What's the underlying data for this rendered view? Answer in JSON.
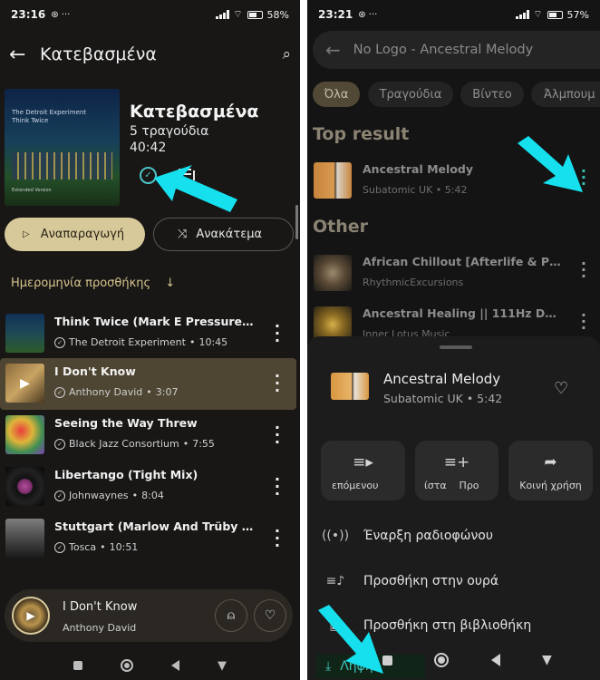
{
  "colors": {
    "accent_gold": "#d8c99b",
    "accent_teal": "#4fc3c6",
    "annotation_arrow": "#16e0ee"
  },
  "left": {
    "status": {
      "time": "23:16",
      "icons": "⊛ ···",
      "battery": "58%"
    },
    "header": {
      "title": "Κατεβασμένα",
      "back_icon": "arrow-left-icon",
      "search_icon": "search-icon"
    },
    "playlist": {
      "title": "Κατεβασμένα",
      "count": "5 τραγούδια",
      "duration": "40:42",
      "cover_text": "The Detroit Experiment\nThink Twice",
      "cover_footer": "Extended Version"
    },
    "actions": {
      "play": "Αναπαραγωγή",
      "shuffle": "Ανακάτεμα"
    },
    "sort": {
      "label": "Ημερομηνία προσθήκης"
    },
    "tracks": [
      {
        "title": "Think Twice (Mark E Pressure D...",
        "artist": "The Detroit Experiment",
        "duration": "10:45"
      },
      {
        "title": "I Don't Know",
        "artist": "Anthony David",
        "duration": "3:07"
      },
      {
        "title": "Seeing the Way Threw",
        "artist": "Black Jazz Consortium",
        "duration": "7:55"
      },
      {
        "title": "Libertango (Tight Mix)",
        "artist": "Johnwaynes",
        "duration": "8:04"
      },
      {
        "title": "Stuttgart (Marlow And Trüby Re...",
        "artist": "Tosca",
        "duration": "10:51"
      }
    ],
    "miniplayer": {
      "title": "I Don't Know",
      "artist": "Anthony David"
    }
  },
  "right": {
    "status": {
      "time": "23:21",
      "icons": "⊛ ···",
      "battery": "57%"
    },
    "search": {
      "query": "No Logo - Ancestral Melody"
    },
    "chips": [
      "Όλα",
      "Τραγούδια",
      "Βίντεο",
      "Άλμπουμ"
    ],
    "top_result_label": "Top result",
    "top_result": {
      "title": "Ancestral Melody",
      "subtitle": "Subatomic UK • 5:42"
    },
    "other_label": "Other",
    "other": [
      {
        "title": "African Chillout [Afterlife & Pet...",
        "subtitle": "RhythmicExcursions"
      },
      {
        "title": "Ancestral Healing || 111Hz Dee...",
        "subtitle": "Inner Lotus Music"
      }
    ],
    "sheet": {
      "title": "Ancestral Melody",
      "subtitle": "Subatomic UK • 5:42",
      "quick_actions": [
        "επόμενου",
        "ίστα    Προ",
        "Κοινή χρήση"
      ],
      "menu": [
        "Έναρξη ραδιοφώνου",
        "Προσθήκη στην ουρά",
        "Προσθήκη στη βιβλιοθήκη"
      ],
      "download": "Λήψη"
    }
  }
}
